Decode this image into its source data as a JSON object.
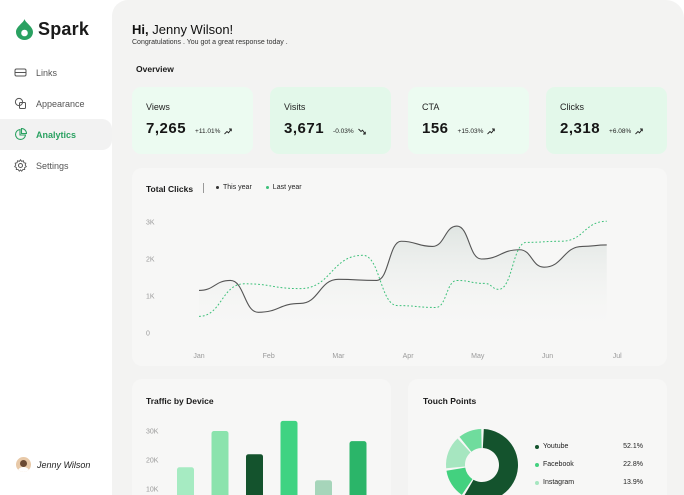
{
  "brand": {
    "name": "Spark",
    "color": "#2aa161"
  },
  "sidebar": {
    "items": [
      {
        "label": "Links",
        "icon": "links-icon",
        "active": false
      },
      {
        "label": "Appearance",
        "icon": "appearance-icon",
        "active": false
      },
      {
        "label": "Analytics",
        "icon": "analytics-icon",
        "active": true
      },
      {
        "label": "Settings",
        "icon": "gear-icon",
        "active": false
      }
    ],
    "user_name": "Jenny Wilson"
  },
  "header": {
    "greeting_prefix": "Hi,",
    "greeting_name": "Jenny Wilson!",
    "subtitle": "Congratulations . You got a great response today ."
  },
  "overview": {
    "title": "Overview",
    "stats": [
      {
        "label": "Views",
        "value": "7,265",
        "change": "+11.01%",
        "trend": "up",
        "bg": "#ecfbf1"
      },
      {
        "label": "Visits",
        "value": "3,671",
        "change": "-0.03%",
        "trend": "down",
        "bg": "#e3f8ea"
      },
      {
        "label": "CTA",
        "value": "156",
        "change": "+15.03%",
        "trend": "up",
        "bg": "#ecfbf1"
      },
      {
        "label": "Clicks",
        "value": "2,318",
        "change": "+6.08%",
        "trend": "up",
        "bg": "#e3f8ea"
      }
    ]
  },
  "total_clicks": {
    "title": "Total Clicks",
    "legend": [
      {
        "label": "This year",
        "color": "#555555"
      },
      {
        "label": "Last year",
        "color": "#3cc079"
      }
    ]
  },
  "traffic": {
    "title": "Traffic by Device"
  },
  "touch_points": {
    "title": "Touch Points",
    "items": [
      {
        "label": "Youtube",
        "value": "52.1%",
        "color": "#14532d"
      },
      {
        "label": "Facebook",
        "value": "22.8%",
        "color": "#43d17f"
      },
      {
        "label": "Instagram",
        "value": "13.9%",
        "color": "#a6e6c0"
      }
    ]
  },
  "chart_data": [
    {
      "type": "line",
      "title": "Total Clicks",
      "x": [
        "Jan",
        "Feb",
        "Mar",
        "Apr",
        "May",
        "Jun",
        "Jul"
      ],
      "yticks": [
        "0",
        "1K",
        "2K",
        "3K"
      ],
      "ylim": [
        0,
        3000
      ],
      "series": [
        {
          "name": "This year",
          "points": [
            [
              0.5,
              1150
            ],
            [
              0.95,
              1420
            ],
            [
              1.35,
              560
            ],
            [
              1.95,
              800
            ],
            [
              2.5,
              1450
            ],
            [
              3.05,
              1420
            ],
            [
              3.4,
              2480
            ],
            [
              3.85,
              2340
            ],
            [
              4.2,
              2890
            ],
            [
              4.55,
              2000
            ],
            [
              5.1,
              2250
            ],
            [
              5.45,
              1780
            ],
            [
              6.0,
              2340
            ],
            [
              6.35,
              2380
            ]
          ]
        },
        {
          "name": "Last year",
          "points": [
            [
              0.5,
              450
            ],
            [
              1.15,
              1330
            ],
            [
              1.95,
              1200
            ],
            [
              2.85,
              2100
            ],
            [
              3.35,
              740
            ],
            [
              3.9,
              690
            ],
            [
              4.2,
              1420
            ],
            [
              4.6,
              1340
            ],
            [
              4.8,
              1180
            ],
            [
              5.2,
              2450
            ],
            [
              5.7,
              2480
            ],
            [
              6.35,
              3020
            ]
          ]
        }
      ],
      "grid": false,
      "legend": "top-left"
    },
    {
      "type": "bar",
      "title": "Traffic by Device",
      "yticks": [
        "10K",
        "20K",
        "30K"
      ],
      "ylim": [
        10000,
        30000
      ],
      "values": [
        17500,
        30000,
        22000,
        33500,
        13000,
        26500
      ],
      "colors": [
        "#a6ebc2",
        "#8be3ad",
        "#14532d",
        "#3fd382",
        "#a6d5ba",
        "#2bb569"
      ]
    },
    {
      "type": "pie",
      "title": "Touch Points",
      "labels": [
        "Youtube",
        "Facebook",
        "Instagram"
      ],
      "values": [
        52.1,
        22.8,
        13.9
      ],
      "colors": [
        "#14532d",
        "#43d17f",
        "#a6e6c0"
      ]
    }
  ]
}
